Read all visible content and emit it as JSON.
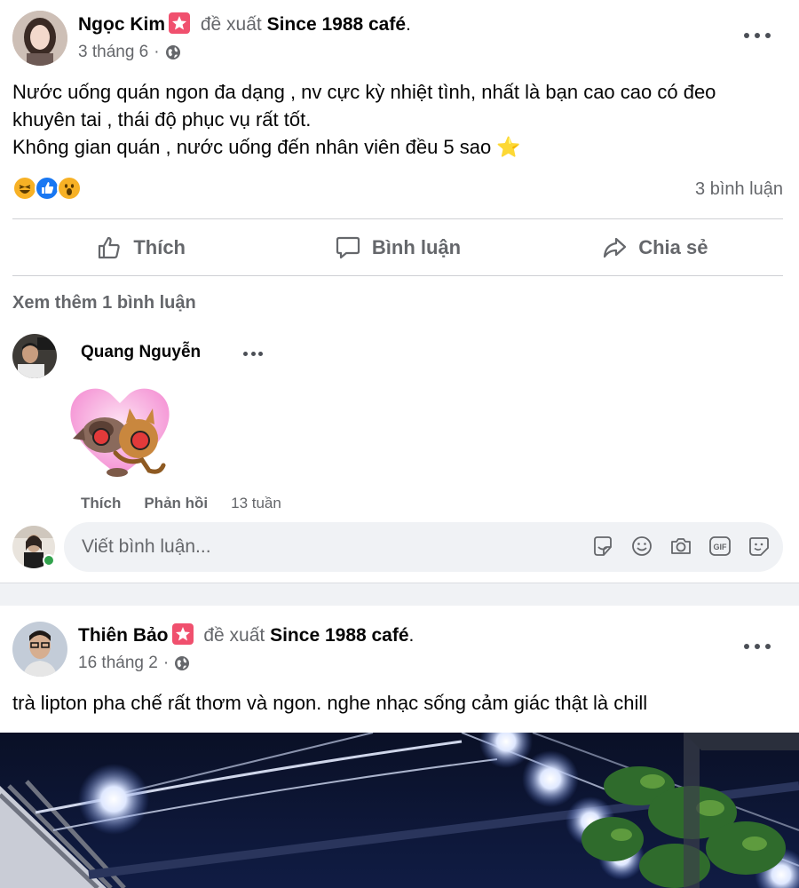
{
  "post1": {
    "author": "Ngọc Kim",
    "verb": "đề xuất",
    "page": "Since 1988 café",
    "period": ".",
    "time": "3 tháng 6",
    "sep": "·",
    "text": "Nước uống quán ngon đa dạng , nv cực kỳ nhiệt tình, nhất là bạn cao cao có đeo\nkhuyên tai , thái độ phục vụ rất tốt.\nKhông gian quán , nước uống đến nhân viên đều 5 sao ⭐",
    "reactions": [
      "haha",
      "like",
      "wow"
    ],
    "comment_count": "3 bình luận",
    "actions": {
      "like": "Thích",
      "comment": "Bình luận",
      "share": "Chia sẻ"
    },
    "see_more": "Xem thêm 1 bình luận",
    "comment": {
      "author": "Quang Nguyễn",
      "like": "Thích",
      "reply": "Phản hồi",
      "time": "13 tuần"
    },
    "composer": {
      "placeholder": "Viết bình luận...",
      "icons": [
        "sticker-icon",
        "emoji-icon",
        "camera-icon",
        "gif-icon",
        "avatar-sticker-icon"
      ]
    }
  },
  "post2": {
    "author": "Thiên Bảo",
    "verb": "đề xuất",
    "page": "Since 1988 café",
    "period": ".",
    "time": "16 tháng 2",
    "sep": "·",
    "text": "trà lipton pha chế rất thơm và ngon. nghe nhạc sống cảm giác thật là chill"
  },
  "colors": {
    "badge": "#f0506e",
    "secondary_text": "#65676b",
    "like_blue": "#1877f2",
    "online": "#31a24c"
  }
}
